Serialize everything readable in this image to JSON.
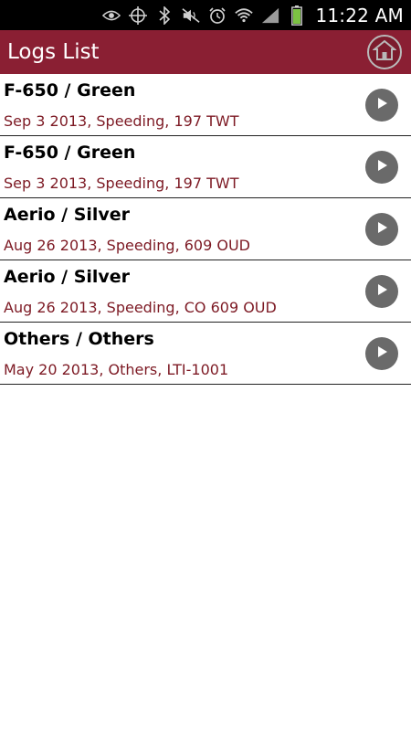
{
  "status_bar": {
    "time": "11:22 AM",
    "icons": [
      "eye-icon",
      "gps-icon",
      "bluetooth-icon",
      "mute-icon",
      "alarm-icon",
      "wifi-icon",
      "signal-icon",
      "battery-icon"
    ]
  },
  "header": {
    "title": "Logs List",
    "home_icon": "home-icon",
    "background_color": "#8a1f33"
  },
  "logs": [
    {
      "title": "F-650 / Green",
      "subtitle": "Sep 3 2013, Speeding, 197 TWT"
    },
    {
      "title": "F-650 / Green",
      "subtitle": "Sep 3 2013, Speeding, 197 TWT"
    },
    {
      "title": "Aerio / Silver",
      "subtitle": "Aug 26 2013, Speeding, 609 OUD"
    },
    {
      "title": "Aerio / Silver",
      "subtitle": "Aug 26 2013, Speeding, CO 609 OUD"
    },
    {
      "title": "Others / Others",
      "subtitle": "May 20 2013, Others, LTI-1001"
    }
  ],
  "colors": {
    "subtitle_text": "#7d1a24",
    "play_button": "#6a6a6a"
  }
}
